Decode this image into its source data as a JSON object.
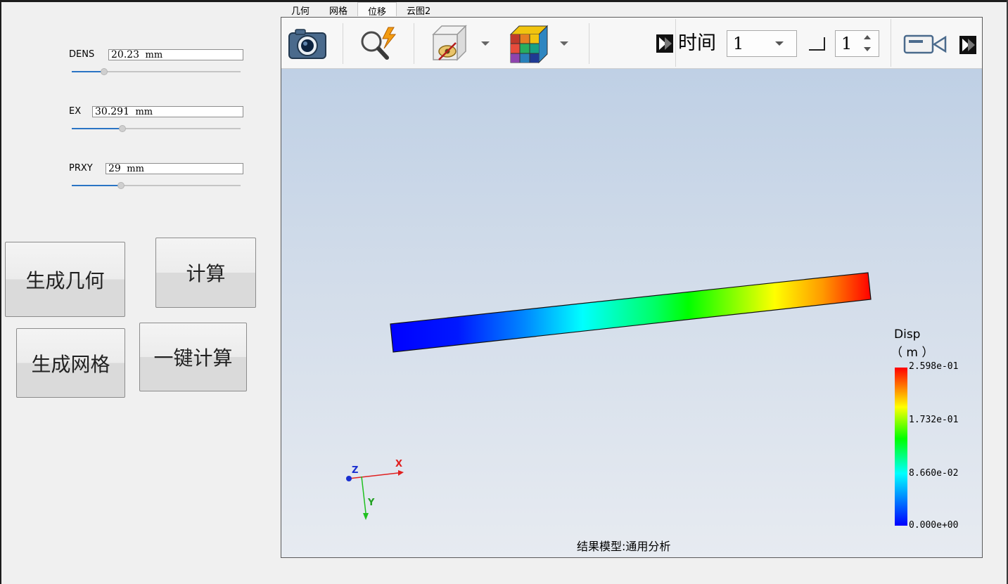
{
  "params": [
    {
      "label": "DENS",
      "value": "20.23",
      "unit": "mm",
      "slider_fraction": 0.19
    },
    {
      "label": "EX",
      "value": "30.291",
      "unit": "mm",
      "slider_fraction": 0.3
    },
    {
      "label": "PRXY",
      "value": "29",
      "unit": "mm",
      "slider_fraction": 0.29
    }
  ],
  "buttons": {
    "gen_geometry": "生成几何",
    "compute": "计算",
    "gen_mesh": "生成网格",
    "one_click": "一键计算"
  },
  "tabs": [
    {
      "label": "几何",
      "active": false
    },
    {
      "label": "网格",
      "active": false
    },
    {
      "label": "位移",
      "active": true
    },
    {
      "label": "云图2",
      "active": false
    }
  ],
  "toolbar": {
    "time_label": "时间",
    "time_value": "1",
    "step_value": "1",
    "icons": [
      "camera-icon",
      "query-icon",
      "hide-visibility-icon",
      "contour-cube-icon",
      "video-record-icon"
    ]
  },
  "legend": {
    "title": "Disp",
    "unit": "（ m ）",
    "ticks": [
      "2.598e-01",
      "1.732e-01",
      "8.660e-02",
      "0.000e+00"
    ],
    "colors": [
      "#ff0000",
      "#ffff00",
      "#00ff00",
      "#00ffff",
      "#0000ff"
    ]
  },
  "axes": {
    "x": "X",
    "y": "Y",
    "z": "Z"
  },
  "status_text": "结果模型:通用分析"
}
